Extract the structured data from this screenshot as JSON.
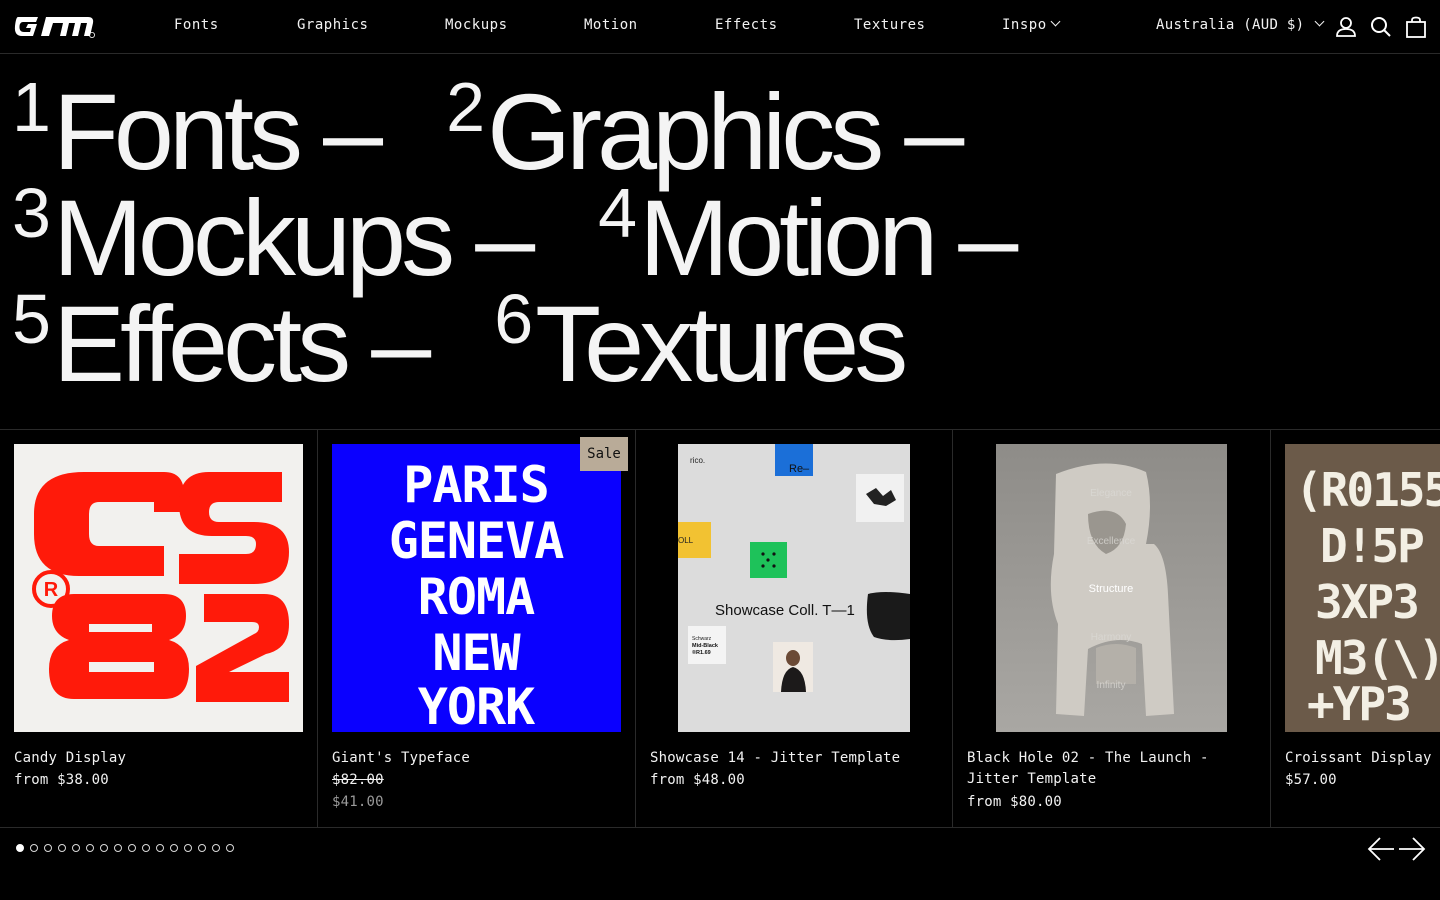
{
  "header": {
    "logo_alt": "GM",
    "nav": [
      {
        "label": "Fonts"
      },
      {
        "label": "Graphics"
      },
      {
        "label": "Mockups"
      },
      {
        "label": "Motion"
      },
      {
        "label": "Effects"
      },
      {
        "label": "Textures"
      },
      {
        "label": "Inspo"
      }
    ],
    "region": "Australia (AUD $)"
  },
  "hero": {
    "items": [
      {
        "num": "1",
        "label": "Fonts –"
      },
      {
        "num": "2",
        "label": "Graphics –"
      },
      {
        "num": "3",
        "label": "Mockups –"
      },
      {
        "num": "4",
        "label": "Motion –"
      },
      {
        "num": "5",
        "label": "Effects –"
      },
      {
        "num": "6",
        "label": "Textures"
      }
    ]
  },
  "products": [
    {
      "title": "Candy Display",
      "price": "from $38.00"
    },
    {
      "title": "Giant's Typeface",
      "price_old": "$82.00",
      "price_sale": "$41.00",
      "badge": "Sale",
      "art_lines": [
        "PARIS",
        "GENEVA",
        "ROMA",
        "NEW",
        "YORK"
      ]
    },
    {
      "title": "Showcase 14 - Jitter Template",
      "price": "from $48.00",
      "art_text": "Showcase Coll. T—1",
      "art_small": [
        "rico.",
        "Re–",
        "Schwarz",
        "Mid-Black",
        "®R1.69",
        "OLL"
      ]
    },
    {
      "title_line1": "Black Hole 02 - The Launch -",
      "title_line2": "Jitter Template",
      "price": "from $80.00",
      "art_words": [
        "Elegance",
        "Excellence",
        "Structure",
        "Harmony",
        "Infinity"
      ]
    },
    {
      "title": "Croissant Display",
      "price": "$57.00",
      "art_lines": [
        "(R0155",
        "D!5P",
        "3XP3",
        "M3(\\)",
        "+YP3"
      ]
    }
  ],
  "carousel": {
    "dot_count": 16,
    "active_index": 0
  },
  "colors": {
    "background": "#000000",
    "text": "#f2f2f2",
    "sale_badge": "#b9ab98",
    "candy_red": "#ff1a0a",
    "giant_blue": "#0a00ff",
    "croissant_brown": "#6b5a49"
  }
}
